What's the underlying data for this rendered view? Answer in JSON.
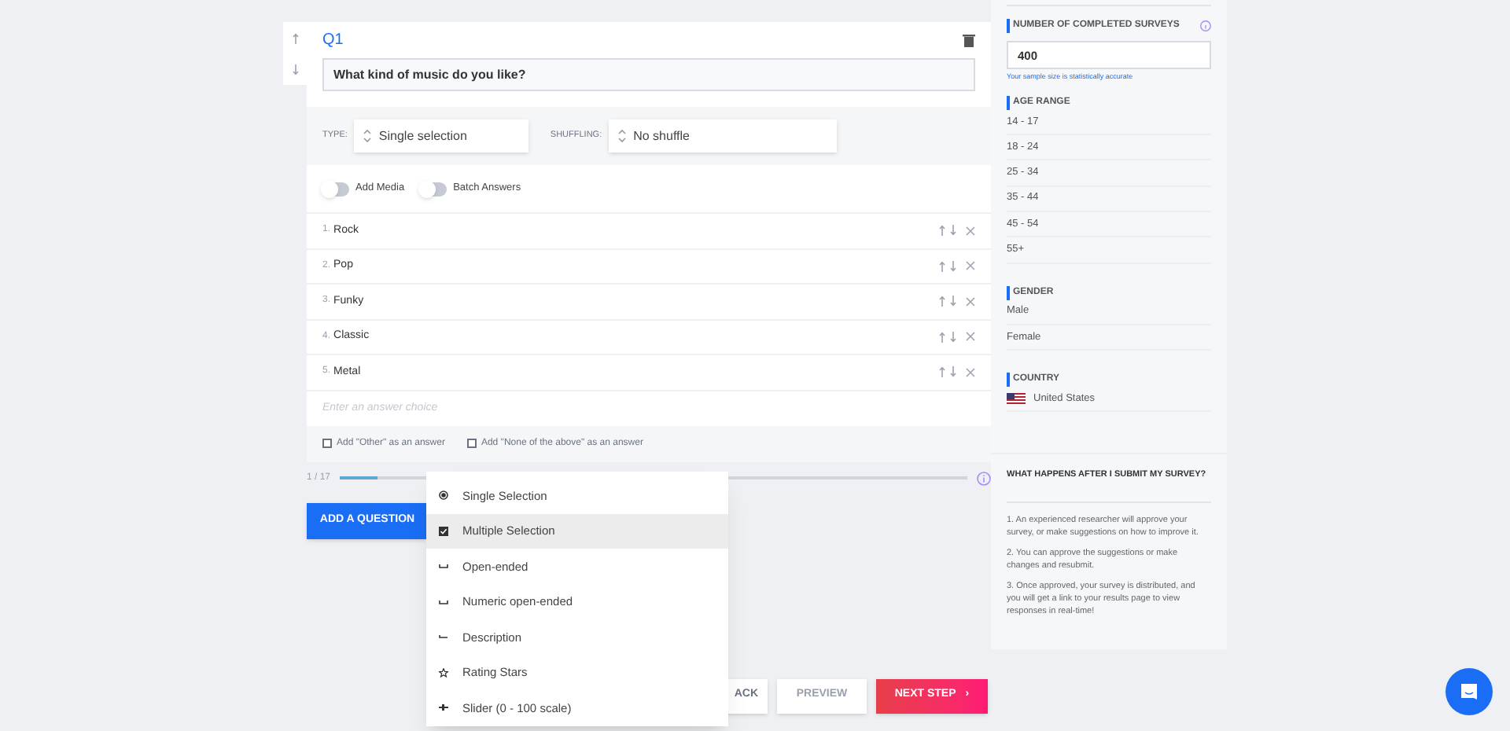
{
  "question": {
    "number": "Q1",
    "text": "What kind of music do you like?"
  },
  "type_select": {
    "label": "TYPE:",
    "value": "Single selection"
  },
  "shuffle_select": {
    "label": "SHUFFLING:",
    "value": "No shuffle"
  },
  "toggles": [
    {
      "label": "Add Media",
      "on": false
    },
    {
      "label": "Batch Answers",
      "on": false
    }
  ],
  "answers": [
    {
      "index": "1.",
      "text": "Rock"
    },
    {
      "index": "2.",
      "text": "Pop"
    },
    {
      "index": "3.",
      "text": "Funky"
    },
    {
      "index": "4.",
      "text": "Classic"
    },
    {
      "index": "5.",
      "text": "Metal"
    }
  ],
  "answer_input": {
    "placeholder": "Enter an answer choice"
  },
  "options": [
    {
      "label": "Add \"Other\" as an answer",
      "checked": false
    },
    {
      "label": "Add \"None of the above\" as an answer",
      "checked": false
    }
  ],
  "progress": {
    "label": "1 / 17",
    "level": 0.06
  },
  "add_question_button": "ADD A QUESTION",
  "type_menu": [
    {
      "kind": "radio",
      "label": "Single Selection",
      "selected": false
    },
    {
      "kind": "checkbox",
      "label": "Multiple Selection",
      "selected": true
    },
    {
      "kind": "line",
      "label": "Open-ended",
      "selected": false
    },
    {
      "kind": "line",
      "label": "Numeric open-ended",
      "selected": false
    },
    {
      "kind": "dash",
      "label": "Description",
      "selected": false
    },
    {
      "kind": "star",
      "label": "Rating Stars",
      "selected": false
    },
    {
      "kind": "slider",
      "label": "Slider (0 - 100 scale)",
      "selected": false
    }
  ],
  "footer_buttons": [
    {
      "kind": "back",
      "label": "ACK"
    },
    {
      "kind": "preview",
      "label": "PREVIEW"
    },
    {
      "kind": "next",
      "label": "NEXT STEP",
      "icon": "›"
    }
  ],
  "sidebar": {
    "surveys": {
      "heading": "NUMBER OF COMPLETED SURVEYS",
      "value": "400",
      "note": "Your sample size is statistically accurate"
    },
    "age": {
      "heading": "AGE RANGE",
      "items": [
        "14 - 17",
        "18 - 24",
        "25 - 34",
        "35 - 44",
        "45 - 54",
        "55+"
      ]
    },
    "gender": {
      "heading": "GENDER",
      "items": [
        "Male",
        "Female"
      ]
    },
    "country": {
      "heading": "COUNTRY",
      "items": [
        "United States"
      ]
    },
    "faq": {
      "heading": "WHAT HAPPENS AFTER I SUBMIT MY SURVEY?",
      "steps": [
        "1. An experienced researcher will approve your survey, or make suggestions on how to improve it.",
        "2. You can approve the suggestions or make changes and resubmit.",
        "3. Once approved, your survey is distributed, and you will get a link to your results page to view responses in real-time!"
      ]
    }
  }
}
